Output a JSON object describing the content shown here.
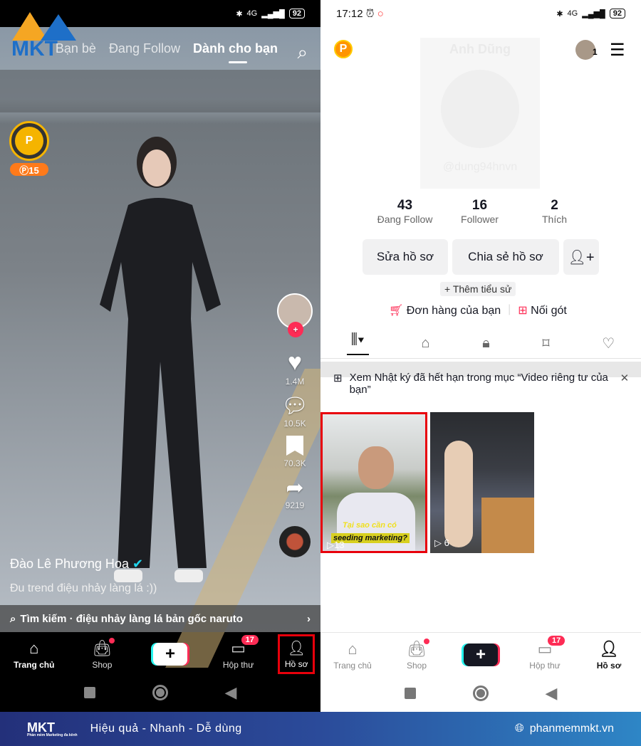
{
  "left_phone": {
    "status_battery": "92",
    "status_network": "4G",
    "feed_tabs": [
      "Bạn bè",
      "Đang Follow",
      "Dành cho bạn"
    ],
    "coin_count": "15",
    "actions": {
      "likes": "1.4M",
      "comments": "10.5K",
      "saves": "70.3K",
      "shares": "9219"
    },
    "author": "Đào Lê Phương Hoa",
    "caption": "Đu trend điệu nhảy làng lá :))",
    "search_suggestion": "Tìm kiếm · điệu nhảy làng lá bản gốc naruto",
    "bottom_nav": [
      {
        "label": "Trang chủ",
        "icon": "home-icon"
      },
      {
        "label": "Shop",
        "icon": "shop-bag-icon"
      },
      {
        "label": "",
        "icon": "plus-icon"
      },
      {
        "label": "Hộp thư",
        "icon": "inbox-icon",
        "badge": "17"
      },
      {
        "label": "Hồ sơ",
        "icon": "profile-icon"
      }
    ],
    "highlight_color": "#e8000b"
  },
  "right_phone": {
    "time": "17:12",
    "status_battery": "92",
    "status_network": "4G",
    "username": "Anh Dũng",
    "handle": "@dung94hnvn",
    "account_badge": "1",
    "stats": [
      {
        "value": "43",
        "label": "Đang Follow"
      },
      {
        "value": "16",
        "label": "Follower"
      },
      {
        "value": "2",
        "label": "Thích"
      }
    ],
    "edit_profile": "Sửa hồ sơ",
    "share_profile": "Chia sẻ hồ sơ",
    "add_bio": "+ Thêm tiểu sử",
    "orders": "Đơn hàng của bạn",
    "noi_got": "Nối gót",
    "notice": "Xem Nhật ký đã hết hạn trong mục “Video riêng tư của bạn”",
    "videos": [
      {
        "views": "13",
        "overlay_line1": "Tại sao cần có",
        "overlay_line2": "seeding marketing?"
      },
      {
        "views": "6"
      }
    ],
    "bottom_nav": [
      {
        "label": "Trang chủ"
      },
      {
        "label": "Shop"
      },
      {
        "label": ""
      },
      {
        "label": "Hộp thư",
        "badge": "17"
      },
      {
        "label": "Hồ sơ"
      }
    ],
    "accent": "#fe2c55"
  },
  "banner": {
    "logo": "MKT",
    "logo_subtitle": "Phần mềm Marketing đa kênh",
    "slogan": "Hiệu quả - Nhanh - Dễ dùng",
    "website": "phanmemmkt.vn"
  }
}
